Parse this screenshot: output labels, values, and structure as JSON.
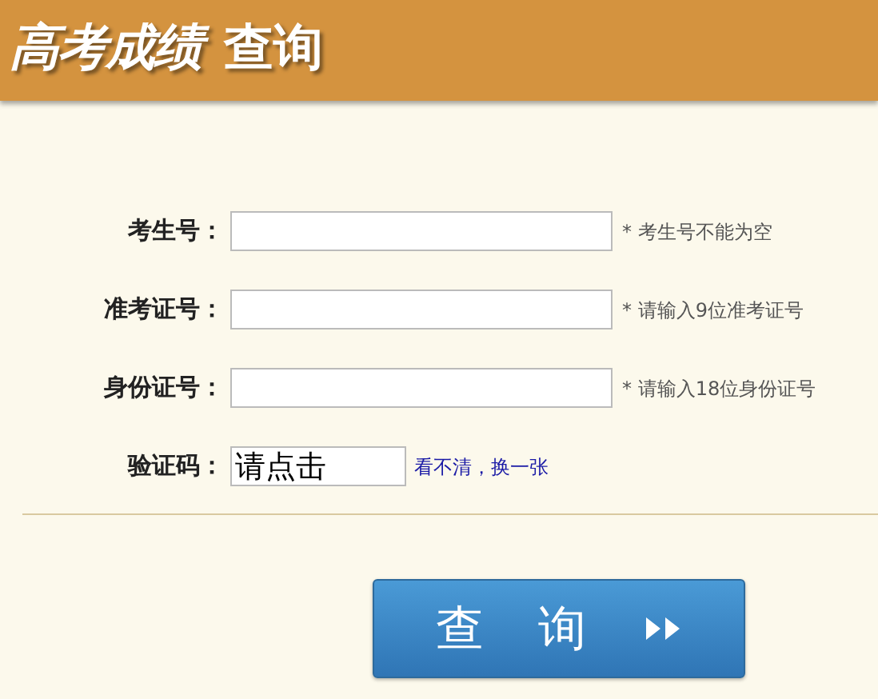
{
  "header": {
    "title": "高考成绩",
    "title_suffix": "查询"
  },
  "fields": [
    {
      "label": "考生号：",
      "hint": "* 考生号不能为空"
    },
    {
      "label": "准考证号：",
      "hint": "* 请输入9位准考证号"
    },
    {
      "label": "身份证号：",
      "hint": "* 请输入18位身份证号"
    }
  ],
  "captcha": {
    "label": "验证码：",
    "image_text": "请点击",
    "refresh_link": "看不清，换一张"
  },
  "submit_button": {
    "label": "查 询"
  }
}
